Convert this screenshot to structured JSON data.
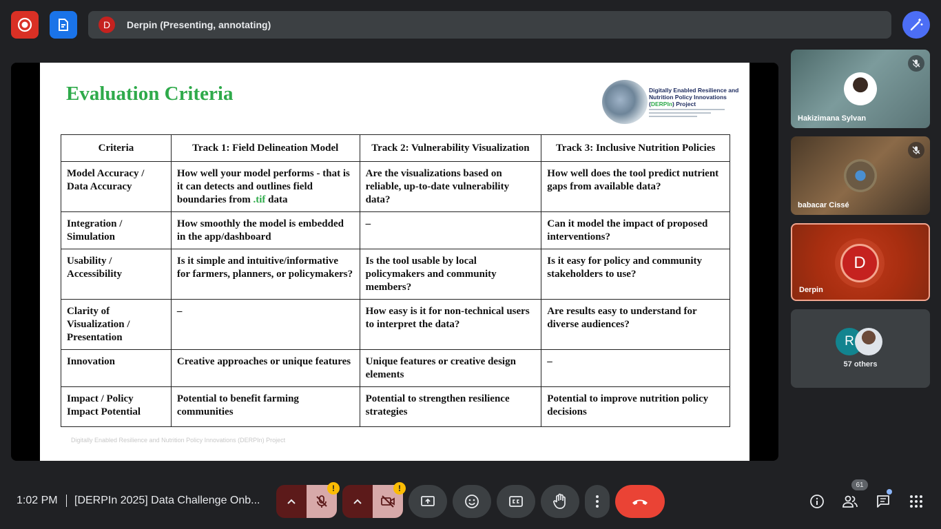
{
  "presenter_bar": {
    "avatar_letter": "D",
    "text": "Derpin (Presenting, annotating)"
  },
  "slide": {
    "title": "Evaluation Criteria",
    "logo": {
      "line1": "Digitally Enabled Resilience and",
      "line2": "Nutrition Policy Innovations",
      "paren_open": "(",
      "acronym": "DERPIn",
      "paren_close": ") Project"
    },
    "headers": [
      "Criteria",
      "Track 1: Field Delineation Model",
      "Track 2: Vulnerability Visualization",
      "Track 3: Inclusive Nutrition Policies"
    ],
    "rows": [
      {
        "criteria": "Model Accuracy / Data Accuracy",
        "t1_pre": "How well your model performs - that is it can detects and outlines field boundaries from ",
        "t1_tif": ".tif",
        "t1_post": " data",
        "t2": "Are the visualizations based on reliable, up-to-date vulnerability data?",
        "t3": "How well does the tool predict nutrient gaps from available data?"
      },
      {
        "criteria": "Integration / Simulation",
        "t1": "How smoothly the model is embedded in the app/dashboard",
        "t2": "–",
        "t3": "Can it model the impact of proposed interventions?"
      },
      {
        "criteria": "Usability / Accessibility",
        "t1": "Is it simple and intuitive/informative for farmers, planners, or policymakers?",
        "t2": "Is the tool usable by local policymakers and community members?",
        "t3": "Is it easy for policy and community stakeholders to use?"
      },
      {
        "criteria": "Clarity of Visualization / Presentation",
        "t1": "–",
        "t2": "How easy is it for non-technical users to interpret the data?",
        "t3": "Are results easy to understand for diverse audiences?"
      },
      {
        "criteria": "Innovation",
        "t1": "Creative approaches or unique features",
        "t2": "Unique features or creative design elements",
        "t3": "–"
      },
      {
        "criteria": "Impact / Policy Impact Potential",
        "t1": "Potential to benefit farming communities",
        "t2": "Potential to strengthen resilience strategies",
        "t3": "Potential to improve nutrition policy decisions"
      }
    ],
    "footer": "Digitally Enabled Resilience and Nutrition Policy Innovations (DERPIn) Project"
  },
  "participants": [
    {
      "name": "Hakizimana Sylvan",
      "muted": true
    },
    {
      "name": "babacar Cissé",
      "muted": true
    },
    {
      "name": "Derpin",
      "avatar_letter": "D"
    },
    {
      "avatar_letter": "R",
      "others_label": "57 others"
    }
  ],
  "bottom": {
    "time": "1:02 PM",
    "meeting_title": "[DERPIn 2025] Data Challenge Onb...",
    "people_count": "61",
    "warning_glyph": "!"
  },
  "colors": {
    "accent_red": "#ea4335",
    "record_red": "#d93025",
    "blue": "#1a73e8",
    "slide_green": "#2eaa4a"
  }
}
